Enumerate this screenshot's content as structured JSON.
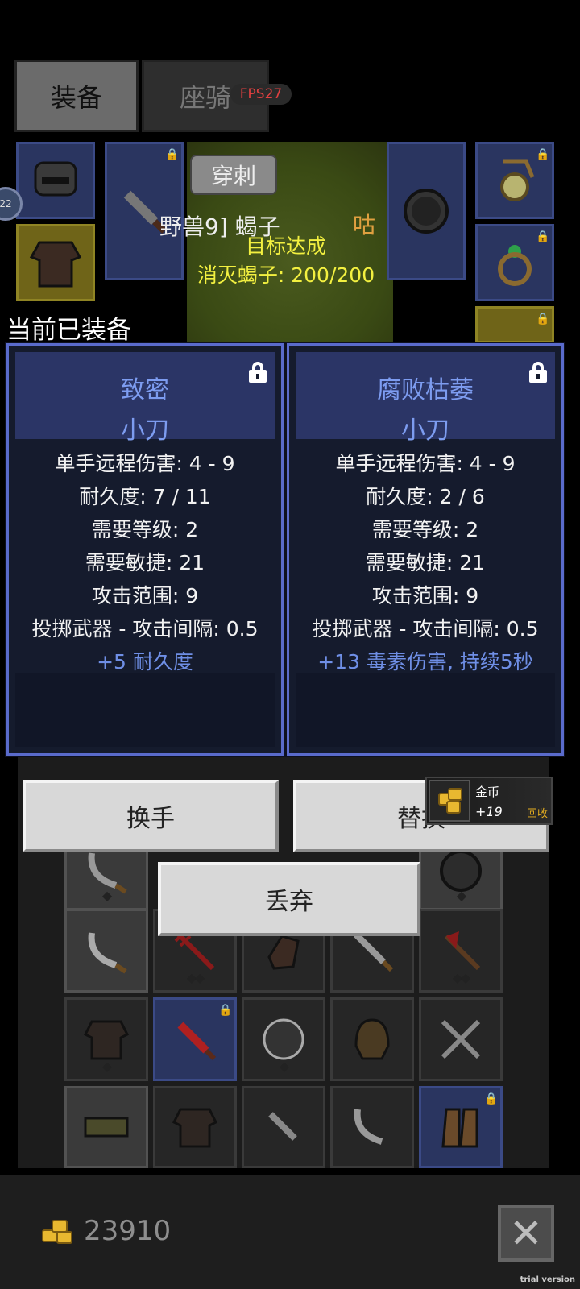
{
  "tabs": {
    "equipment": "装备",
    "mount": "座骑"
  },
  "fps": "FPS27",
  "scene": {
    "pierce_label": "穿刺",
    "mob_name": "野兽9] 蝎子",
    "side_text": "咕",
    "goal_title": "目标达成",
    "goal_progress": "消灭蝎子: 200/200",
    "left_badge": "22"
  },
  "current_label": "当前已装备",
  "cards": [
    {
      "name": "致密",
      "type": "小刀",
      "stats": [
        "单手远程伤害: 4 - 9",
        "耐久度: 7 / 11",
        "需要等级: 2",
        "需要敏捷: 21",
        "攻击范围: 9",
        "投掷武器 - 攻击间隔: 0.5"
      ],
      "magic": "+5 耐久度"
    },
    {
      "name": "腐败枯萎",
      "type": "小刀",
      "stats": [
        "单手远程伤害: 4 - 9",
        "耐久度: 2 / 6",
        "需要等级: 2",
        "需要敏捷: 21",
        "攻击范围: 9",
        "投掷武器 - 攻击间隔: 0.5"
      ],
      "magic": "+13 毒素伤害, 持续5秒"
    }
  ],
  "buttons": {
    "swap": "换手",
    "replace": "替换",
    "drop": "丢弃"
  },
  "toast": {
    "title": "金币",
    "amount": "+19",
    "action": "回收"
  },
  "gold": {
    "amount": "23910"
  },
  "watermark": "trial version",
  "colors": {
    "card_border": "#5a6bcc",
    "card_name": "#7d9cf0",
    "goal_text": "#f3f040",
    "fps": "#e04040"
  }
}
